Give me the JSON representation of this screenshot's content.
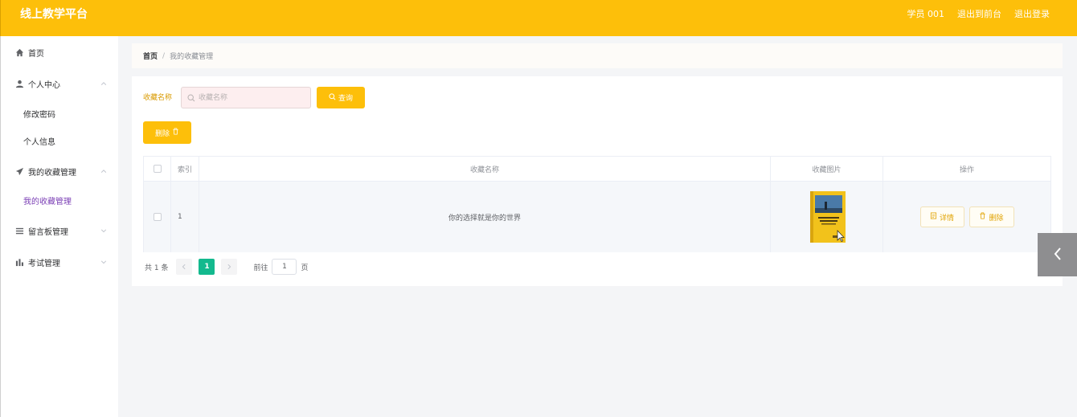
{
  "header": {
    "brand": "线上教学平台",
    "user": "学员 001",
    "back_to_front": "退出到前台",
    "logout": "退出登录"
  },
  "sidebar": {
    "items": [
      {
        "label": "首页",
        "icon": "home-icon"
      },
      {
        "label": "个人中心",
        "icon": "user-icon",
        "expanded": true,
        "children": [
          {
            "label": "修改密码"
          },
          {
            "label": "个人信息"
          }
        ]
      },
      {
        "label": "我的收藏管理",
        "icon": "paper-plane-icon",
        "expanded": true,
        "children": [
          {
            "label": "我的收藏管理",
            "active": true
          }
        ]
      },
      {
        "label": "留言板管理",
        "icon": "list-icon",
        "expanded": false
      },
      {
        "label": "考试管理",
        "icon": "bar-chart-icon",
        "expanded": false
      }
    ]
  },
  "breadcrumb": {
    "home": "首页",
    "separator": "/",
    "current": "我的收藏管理"
  },
  "search": {
    "label": "收藏名称",
    "placeholder": "收藏名称",
    "value": "",
    "button": "查询"
  },
  "toolbar": {
    "delete_label": "删除"
  },
  "table": {
    "headers": {
      "index": "索引",
      "name": "收藏名称",
      "image": "收藏图片",
      "actions": "操作"
    },
    "rows": [
      {
        "index": "1",
        "name": "你的选择就是你的世界",
        "image": "book-cover",
        "detail": "详情",
        "delete": "删除"
      }
    ]
  },
  "pagination": {
    "total": "共 1 条",
    "current": "1",
    "goto_prefix": "前往",
    "goto_value": "1",
    "goto_suffix": "页"
  },
  "colors": {
    "primary": "#fdbf0a",
    "active_menu": "#7b3fb5",
    "page_active": "#13b98e"
  }
}
